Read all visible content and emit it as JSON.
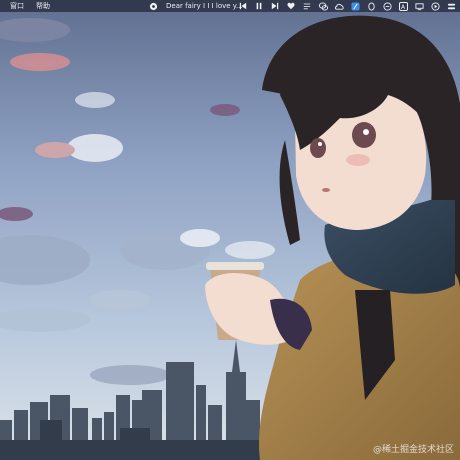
{
  "menubar": {
    "menus": [
      "窗口",
      "帮助"
    ],
    "now_playing": {
      "app_icon": "music-app-icon",
      "track": "Dear fairy I I I love y..."
    },
    "player_controls": [
      "previous-icon",
      "pause-icon",
      "next-icon",
      "heart-icon",
      "playlist-icon"
    ],
    "status_icons": [
      "wechat-icon",
      "cloud-icon",
      "feather-icon",
      "qq-icon",
      "vpn-icon",
      "text-input-icon",
      "display-icon",
      "play-circle-icon",
      "control-center-icon"
    ],
    "input_method": "A"
  },
  "wallpaper": {
    "description_icon": "anime-girl-wallpaper"
  },
  "watermark": "@稀土掘金技术社区"
}
